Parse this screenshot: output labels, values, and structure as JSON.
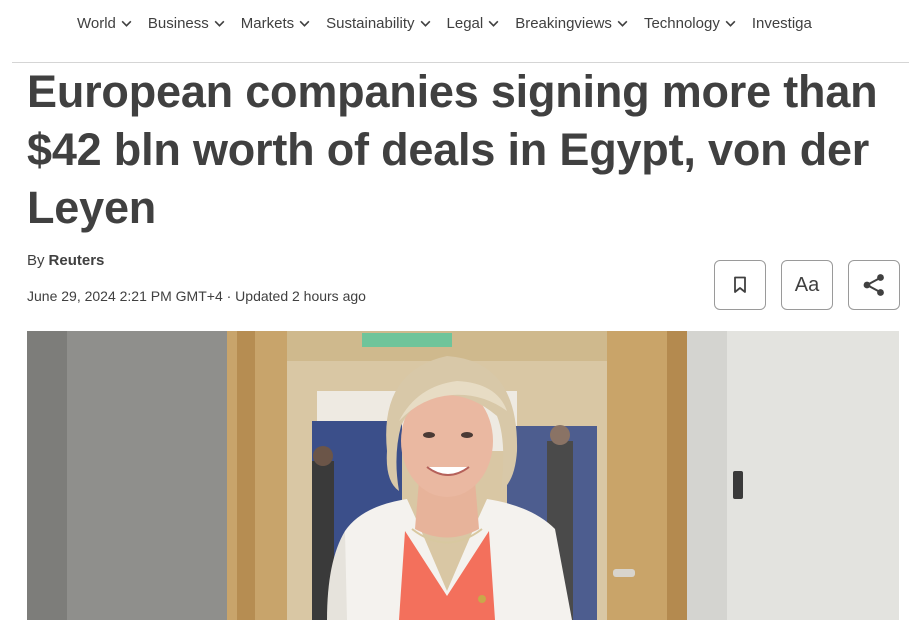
{
  "nav": {
    "items": [
      {
        "label": "World"
      },
      {
        "label": "Business"
      },
      {
        "label": "Markets"
      },
      {
        "label": "Sustainability"
      },
      {
        "label": "Legal"
      },
      {
        "label": "Breakingviews"
      },
      {
        "label": "Technology"
      },
      {
        "label": "Investiga"
      }
    ],
    "chevron_icon": "chevron-down-icon"
  },
  "article": {
    "headline": "European companies signing more than $42 bln worth of deals in Egypt, von der Leyen",
    "by_prefix": "By",
    "author": "Reuters",
    "dateline": "June 29, 2024 2:21 PM GMT+4 · Updated 2 hours ago"
  },
  "actions": {
    "bookmark_icon": "bookmark-icon",
    "font_label": "Aa",
    "share_icon": "share-icon"
  },
  "colors": {
    "text": "#404040",
    "border": "#9a9a9a",
    "jacket": "#f4f2ee",
    "blouse": "#f3705c"
  }
}
